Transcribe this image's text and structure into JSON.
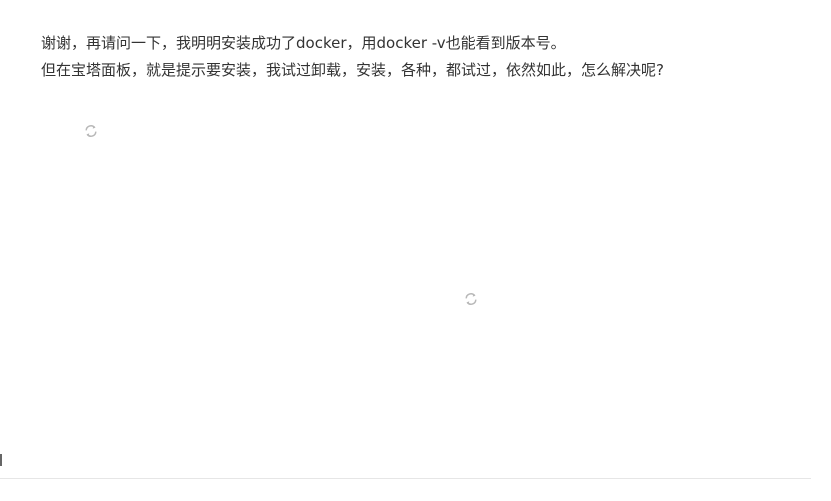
{
  "post": {
    "lines": [
      "谢谢，再请问一下，我明明安装成功了docker，用docker -v也能看到版本号。",
      "但在宝塔面板，就是提示要安装，我试过卸载，安装，各种，都试过，依然如此，怎么解决呢?"
    ]
  },
  "images": [
    {
      "icon": "image-loading-icon",
      "state": "loading"
    },
    {
      "icon": "image-loading-icon",
      "state": "loading"
    }
  ],
  "colors": {
    "text": "#333333",
    "icon": "#b8b8b8",
    "divider": "#e6e6e6",
    "background": "#ffffff"
  }
}
